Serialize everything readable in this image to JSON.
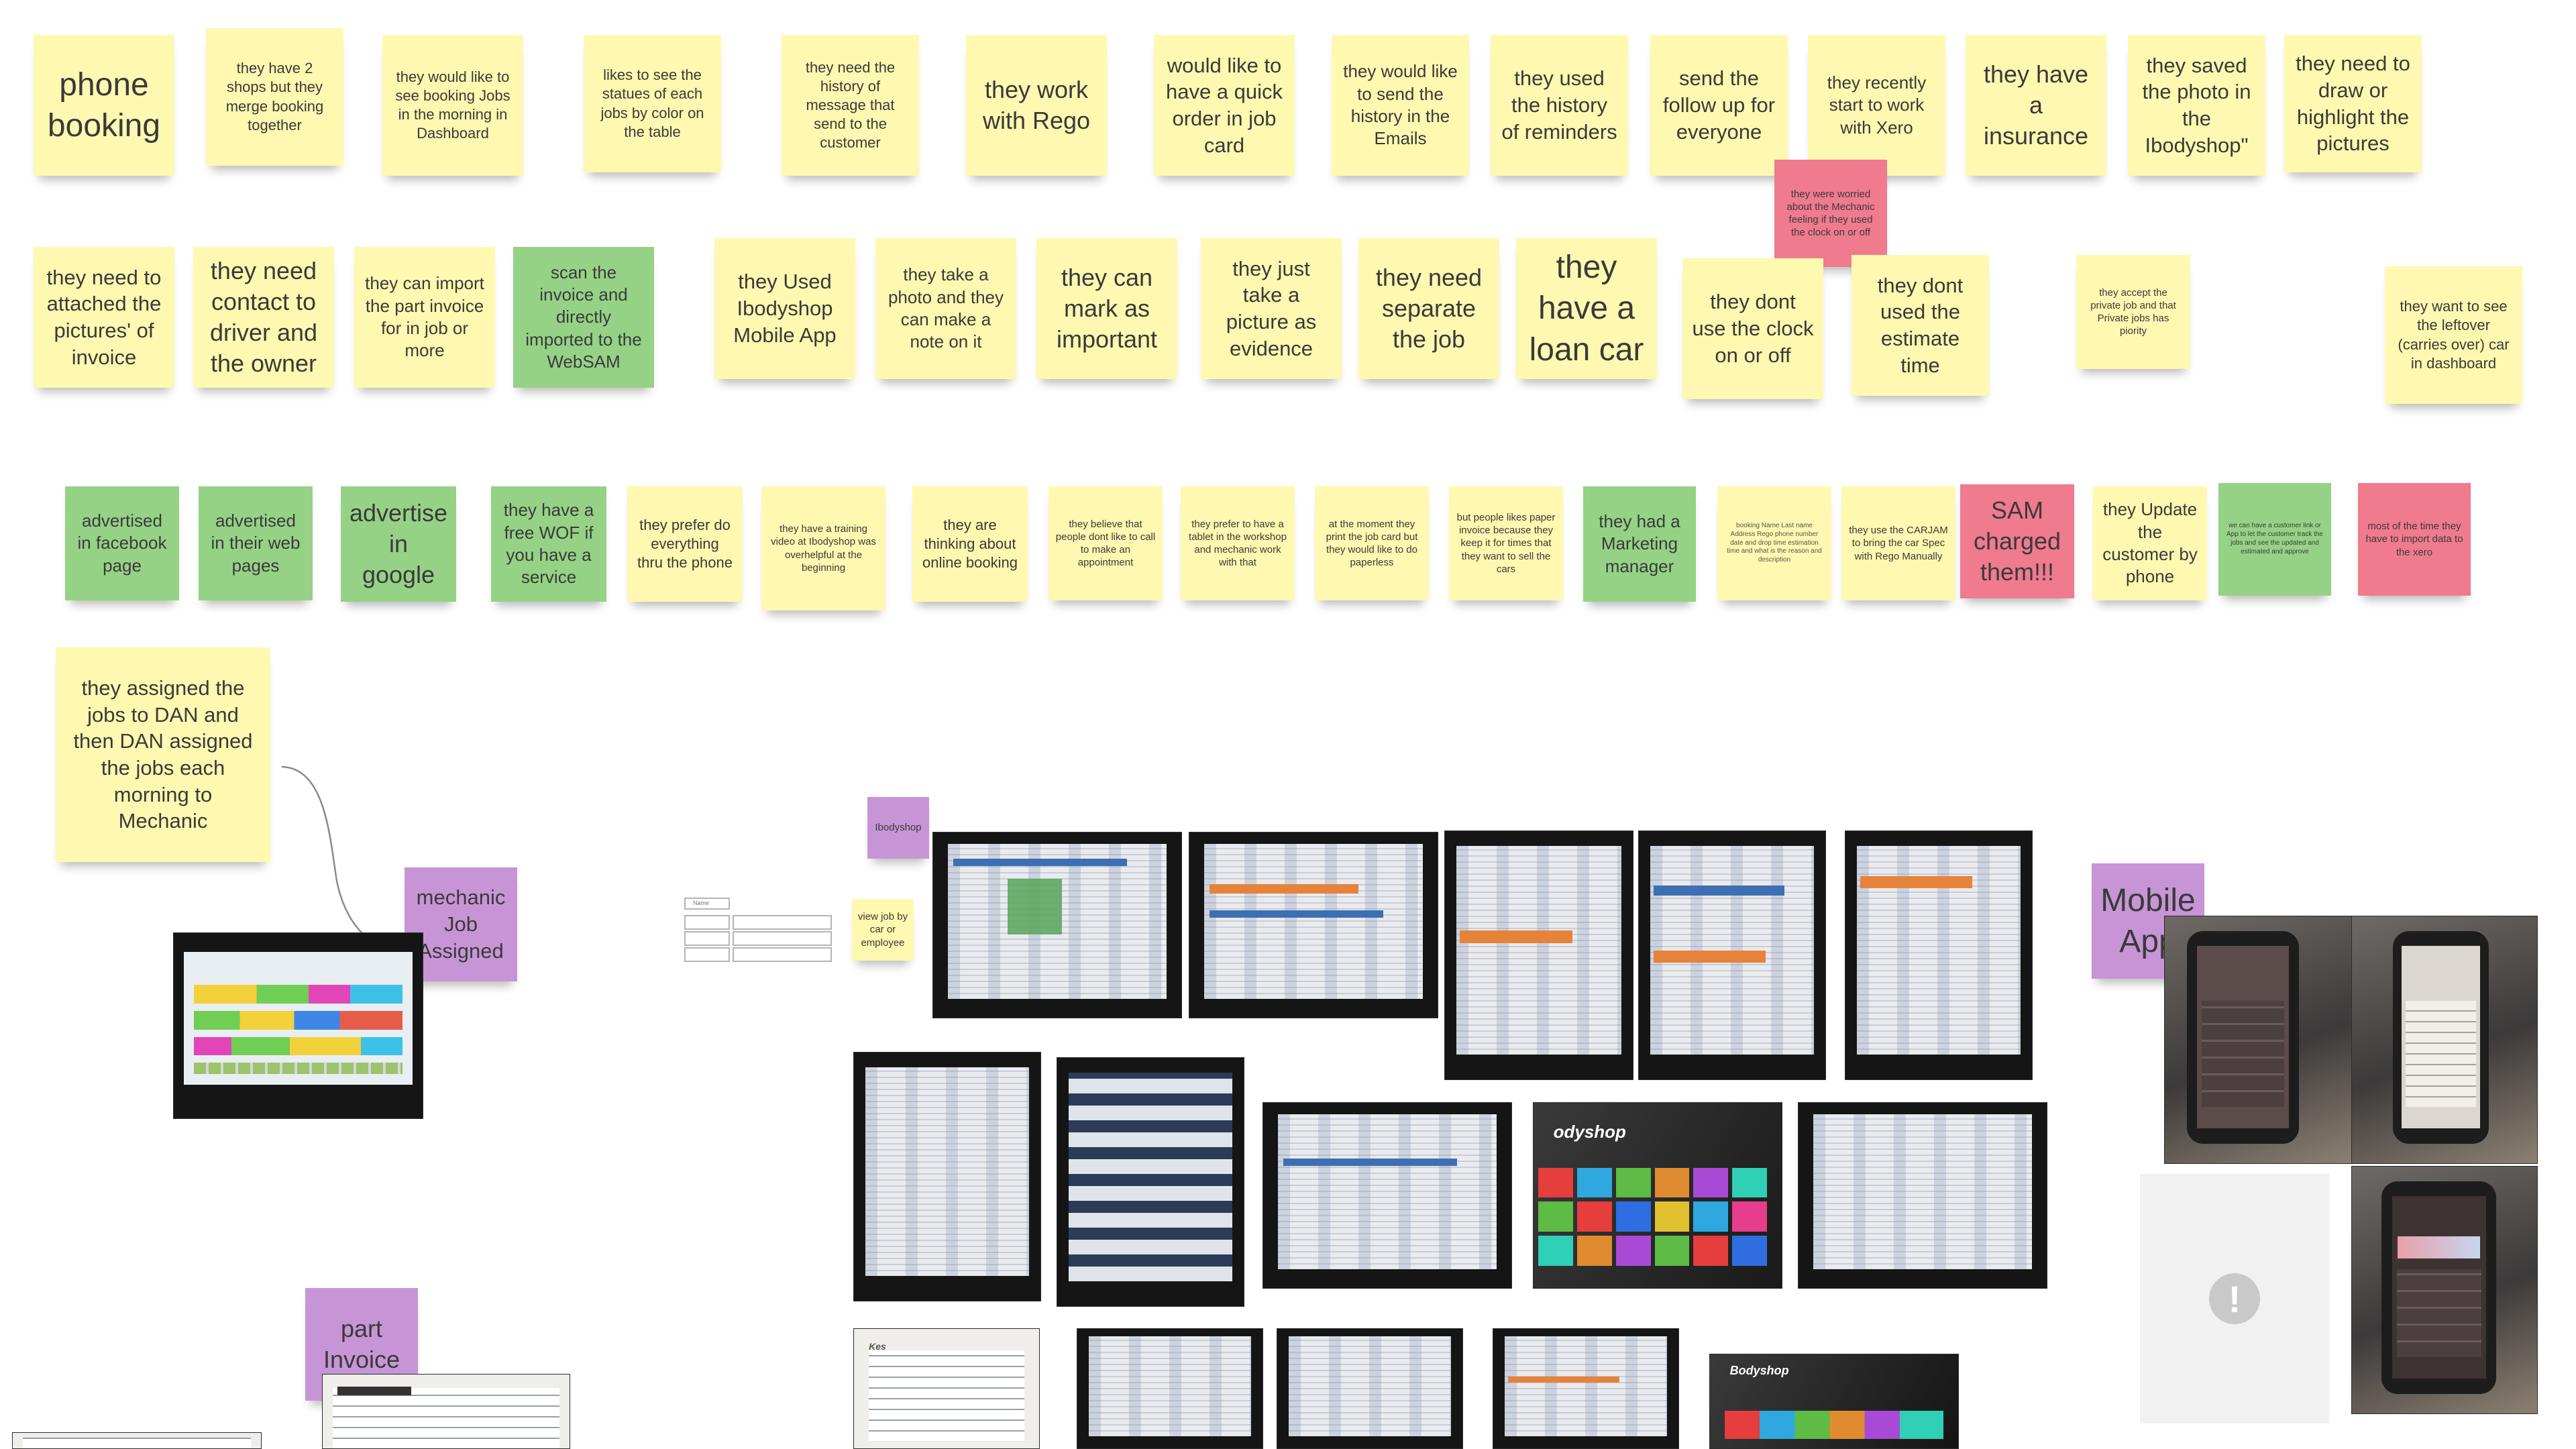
{
  "stickies": {
    "phone_booking": "phone booking",
    "two_shops": "they have 2 shops but they merge booking together",
    "booking_morning": "they would like to see booking Jobs in the morning in Dashboard",
    "status_color": "likes to see the statues of each jobs by color on the table",
    "history_message": "they need the history of message that send to the customer",
    "work_rego": "they work with Rego",
    "quick_order": "would like to have a quick order in job card",
    "history_emails": "they would like to send the history in the Emails",
    "history_reminders": "they used the history of reminders",
    "follow_up": "send the follow up for everyone",
    "xero": "they recently start to work with Xero",
    "insurance": "they have a insurance",
    "saved_photo": "they saved the photo in the Ibodyshop\"",
    "draw_highlight": "they need to draw or highlight the pictures",
    "worried_mechanic": "they were worried about the Mechanic feeling if they used the clock on or off",
    "attach_pictures": "they need to attached the pictures' of invoice",
    "contact_driver": "they need contact to driver and the owner",
    "import_part_invoice": "they can import the part invoice for in job or more",
    "scan_invoice": "scan the invoice and directly imported to the WebSAM",
    "used_mobile_app": "they Used Ibodyshop Mobile App",
    "photo_note": "they take a photo and they can make a note on it",
    "mark_important": "they can mark as important",
    "picture_evidence": "they just take a picture as evidence",
    "separate_job": "they need separate the job",
    "loan_car": "they have a loan car",
    "clock_on_off": "they dont use the clock on or off",
    "estimate_time": "they dont used the estimate time",
    "private_job": "they accept the private job and that Private jobs has piority",
    "leftover": "they want to see the leftover (carries over) car in dashboard",
    "facebook": "advertised in facebook page",
    "web_pages": "advertised in their web pages",
    "google": "advertise in google",
    "free_wof": "they have a free WOF if you have a service",
    "prefer_phone": "they prefer do everything thru the phone",
    "training_video": "they have a training video at Ibodyshop was overhelpful at the beginning",
    "online_booking": "they are thinking about online booking",
    "call_appointment": "they believe that people dont like to call to make an appointment",
    "tablet_workshop": "they prefer to have a tablet in the workshop and mechanic work with that",
    "print_job_card": "at the moment they print the job card but they would like to do paperless",
    "paper_invoice": "but people likes paper invoice because they keep it for times that they want to sell the cars",
    "marketing_manager": "they had a Marketing manager",
    "booking_fields": "booking Name Last name Address Rego phone number date and drop time estimation time and what is the reason and description",
    "carjam": "they use the CARJAM to bring the car Spec with Rego Manually",
    "sam_charged": "SAM charged them!!!",
    "update_customer": "they Update the customer by phone",
    "customer_link": "we can have a customer link or App to let the customer track the jobs and see the updated and estimated and approve",
    "import_xero": "most of the time they have to import data to the xero",
    "assigned_dan": "they assigned the jobs to DAN and then DAN assigned the jobs each morning to Mechanic",
    "mechanic_job_assigned": "mechanic Job Assigned",
    "ibodyshop": "Ibodyshop",
    "view_job": "view job by car or employee",
    "mobile_app": "Mobile App",
    "part_invoice": "part Invoice"
  },
  "wireframe": {
    "label": "Name"
  },
  "photos": {
    "overlay_brand_1": "odyshop",
    "overlay_brand_2": "Bodyshop",
    "overlay_scan": "Kes"
  },
  "icons": {
    "image_error": "!"
  },
  "colors": {
    "yellow": "#fff8b0",
    "green": "#95d286",
    "pink": "#f07a8e",
    "purple": "#c795d6"
  }
}
